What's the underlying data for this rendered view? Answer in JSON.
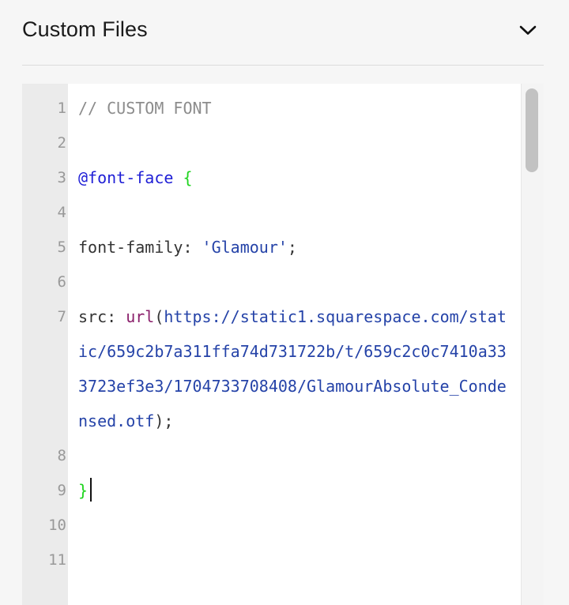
{
  "panel": {
    "title": "Custom Files"
  },
  "icons": {
    "collapse": "chevron-down-icon"
  },
  "editor": {
    "lines": [
      {
        "number": "1",
        "tokens": [
          {
            "text": "// CUSTOM FONT",
            "type": "comment"
          }
        ]
      },
      {
        "number": "2",
        "tokens": []
      },
      {
        "number": "3",
        "tokens": [
          {
            "text": "@font-face",
            "type": "atrule"
          },
          {
            "text": " ",
            "type": "plain"
          },
          {
            "text": "{",
            "type": "brace"
          }
        ]
      },
      {
        "number": "4",
        "tokens": []
      },
      {
        "number": "5",
        "tokens": [
          {
            "text": "font-family: ",
            "type": "plain"
          },
          {
            "text": "'Glamour'",
            "type": "string"
          },
          {
            "text": ";",
            "type": "plain"
          }
        ]
      },
      {
        "number": "6",
        "tokens": []
      },
      {
        "number": "7",
        "tokens": [
          {
            "text": "src: ",
            "type": "plain"
          },
          {
            "text": "url",
            "type": "func"
          },
          {
            "text": "(",
            "type": "plain"
          },
          {
            "text": "https://static1.squarespace.com/static/659c2b7a311ffa74d731722b/t/659c2c0c7410a333723ef3e3/1704733708408/GlamourAbsolute_Condensed.otf",
            "type": "url"
          },
          {
            "text": ");",
            "type": "plain"
          }
        ]
      },
      {
        "number": "8",
        "tokens": []
      },
      {
        "number": "9",
        "tokens": [
          {
            "text": "}",
            "type": "brace"
          }
        ],
        "caret": true
      },
      {
        "number": "10",
        "tokens": []
      },
      {
        "number": "11",
        "tokens": []
      }
    ]
  },
  "colors": {
    "comment": "#8c8c8c",
    "atrule": "#1f1fd6",
    "brace": "#1fd41f",
    "string": "#2543a8",
    "func": "#8a1f6b",
    "plain": "#333333"
  }
}
